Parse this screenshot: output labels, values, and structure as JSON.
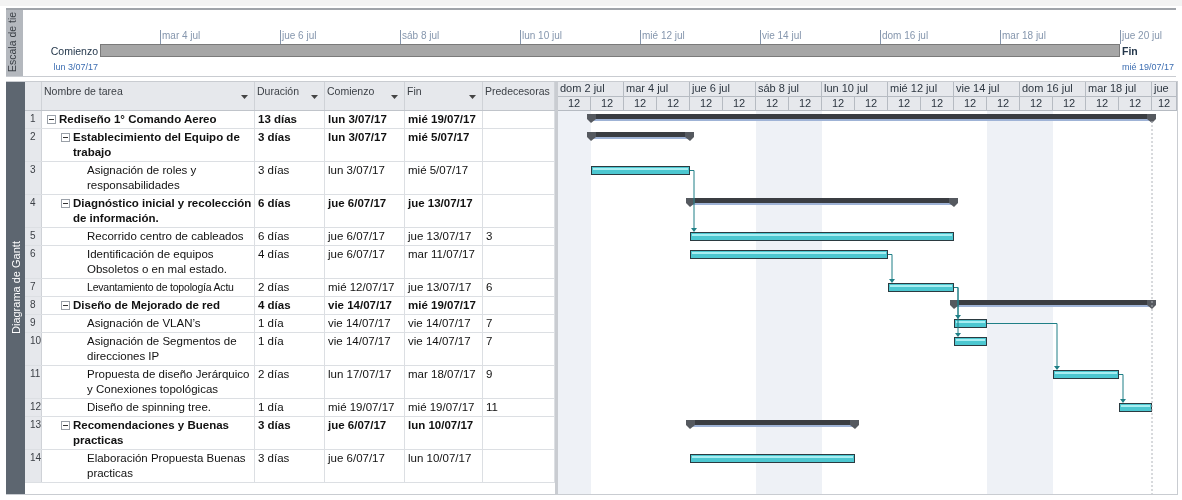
{
  "timeline": {
    "side_label": "Escala de tie",
    "start_label": "Comienzo",
    "start_date": "lun 3/07/17",
    "end_label": "Fin",
    "end_date": "mié 19/07/17",
    "ticks": [
      "mar 4 jul",
      "jue 6 jul",
      "sáb 8 jul",
      "lun 10 jul",
      "mié 12 jul",
      "vie 14 jul",
      "dom 16 jul",
      "mar 18 jul",
      "jue 20 jul"
    ]
  },
  "view_label": "Diagrama de Gantt",
  "table": {
    "columns": [
      {
        "label": "Nombre de tarea",
        "dropdown": true
      },
      {
        "label": "Duración",
        "dropdown": true
      },
      {
        "label": "Comienzo",
        "dropdown": true
      },
      {
        "label": "Fin",
        "dropdown": true
      },
      {
        "label": "Predecesoras",
        "dropdown": false
      }
    ],
    "rows": [
      {
        "id": "1",
        "kind": "summary",
        "expanded": true,
        "name": "Rediseño 1° Comando Aereo",
        "duration": "13 días",
        "start": "lun 3/07/17",
        "finish": "mié 19/07/17",
        "children": [
          {
            "id": "2",
            "kind": "summary",
            "expanded": true,
            "name": "Establecimiento del Equipo de trabajo",
            "duration": "3 días",
            "start": "lun 3/07/17",
            "finish": "mié 5/07/17",
            "children": [
              {
                "id": "3",
                "kind": "task",
                "name": "Asignación de roles y responsabilidades",
                "duration": "3 días",
                "start": "lun 3/07/17",
                "finish": "mié 5/07/17"
              }
            ]
          },
          {
            "id": "4",
            "kind": "summary",
            "expanded": true,
            "name": "Diagnóstico inicial y recolección de información.",
            "duration": "6 días",
            "start": "jue 6/07/17",
            "finish": "jue 13/07/17",
            "children": [
              {
                "id": "5",
                "kind": "task",
                "name": "Recorrido centro de cableados",
                "duration": "6 días",
                "start": "jue 6/07/17",
                "finish": "jue 13/07/17",
                "predecessors": "3"
              },
              {
                "id": "6",
                "kind": "task",
                "name": "Identificación de equipos Obsoletos o en mal estado.",
                "duration": "4 días",
                "start": "jue 6/07/17",
                "finish": "mar 11/07/17"
              },
              {
                "id": "7",
                "kind": "task",
                "name": "Levantamiento de topología Actu",
                "clipped": true,
                "duration": "2 días",
                "start": "mié 12/07/17",
                "finish": "jue 13/07/17",
                "predecessors": "6"
              }
            ]
          },
          {
            "id": "8",
            "kind": "summary",
            "expanded": true,
            "name": "Diseño de Mejorado de red",
            "duration": "4 días",
            "start": "vie 14/07/17",
            "finish": "mié 19/07/17",
            "children": [
              {
                "id": "9",
                "kind": "task",
                "name": "Asignación de VLAN’s",
                "duration": "1 día",
                "start": "vie 14/07/17",
                "finish": "vie 14/07/17",
                "predecessors": "7"
              },
              {
                "id": "10",
                "kind": "task",
                "name": "Asignación de Segmentos de direcciones IP",
                "duration": "1 día",
                "start": "vie 14/07/17",
                "finish": "vie 14/07/17",
                "predecessors": "7"
              },
              {
                "id": "11",
                "kind": "task",
                "name": "Propuesta de diseño Jerárquico y Conexiones topológicas",
                "duration": "2 días",
                "start": "lun 17/07/17",
                "finish": "mar 18/07/17",
                "predecessors": "9"
              },
              {
                "id": "12",
                "kind": "task",
                "name": "Diseño de spinning tree.",
                "duration": "1 día",
                "start": "mié 19/07/17",
                "finish": "mié 19/07/17",
                "predecessors": "11"
              }
            ]
          },
          {
            "id": "13",
            "kind": "summary",
            "expanded": true,
            "name": "Recomendaciones y Buenas practicas",
            "duration": "3 días",
            "start": "jue 6/07/17",
            "finish": "lun 10/07/17",
            "children": [
              {
                "id": "14",
                "kind": "task",
                "name": "Elaboración Propuesta Buenas practicas",
                "duration": "3 días",
                "start": "jue 6/07/17",
                "finish": "lun 10/07/17"
              }
            ]
          }
        ]
      }
    ]
  },
  "gantt": {
    "scale_major": [
      "dom 2 jul",
      "mar 4 jul",
      "jue 6 jul",
      "sáb 8 jul",
      "lun 10 jul",
      "mié 12 jul",
      "vie 14 jul",
      "dom 16 jul",
      "mar 18 jul",
      "jue"
    ],
    "scale_minor": [
      "12",
      "12",
      "12",
      "12",
      "12",
      "12",
      "12",
      "12",
      "12",
      "12",
      "12",
      "12",
      "12",
      "12",
      "12",
      "12",
      "12",
      "12",
      "12"
    ]
  }
}
